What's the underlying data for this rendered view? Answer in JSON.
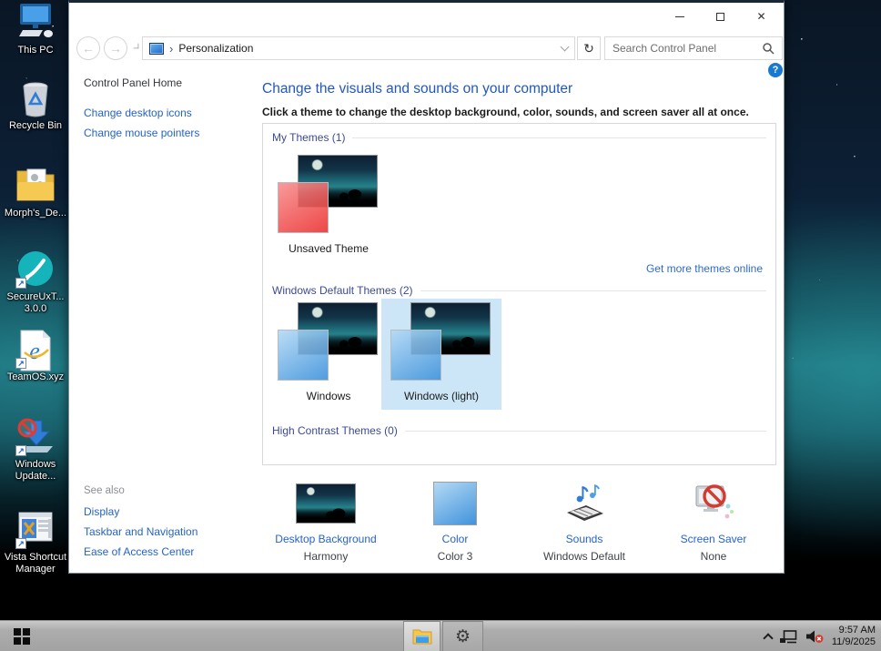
{
  "colors": {
    "link_blue": "#2563c9",
    "heading_blue": "#2156c6",
    "group_label_blue": "#3b4a97",
    "selection_blue": "#cde6f7",
    "help_blue": "#1878d2",
    "overlay_red": "#ee3c3c",
    "overlay_blue": "#4294db",
    "taskbar_gray": "#adadad"
  },
  "desktop": {
    "icons": [
      {
        "name": "this-pc",
        "label": "This PC"
      },
      {
        "name": "recycle-bin",
        "label": "Recycle Bin"
      },
      {
        "name": "morphs-folder",
        "label": "Morph's_De..."
      },
      {
        "name": "secureux-tool",
        "label": "SecureUxT... 3.0.0"
      },
      {
        "name": "teamos-link",
        "label": "TeamOS.xyz"
      },
      {
        "name": "windows-update-blocker",
        "label": "Windows Update..."
      },
      {
        "name": "vista-shortcut-manager",
        "label": "Vista Shortcut Manager"
      }
    ]
  },
  "window": {
    "address": "Personalization",
    "search_placeholder": "Search Control Panel",
    "sidebar": {
      "home": "Control Panel Home",
      "links": [
        "Change desktop icons",
        "Change mouse pointers"
      ],
      "see_also_title": "See also",
      "see_also_links": [
        "Display",
        "Taskbar and Navigation",
        "Ease of Access Center"
      ]
    },
    "main": {
      "heading": "Change the visuals and sounds on your computer",
      "subtitle": "Click a theme to change the desktop background, color, sounds, and screen saver all at once.",
      "my_themes_label": "My Themes (1)",
      "unsaved_theme": "Unsaved Theme",
      "get_more_link": "Get more themes online",
      "default_themes_label": "Windows Default Themes (2)",
      "theme_windows": "Windows",
      "theme_windows_light": "Windows (light)",
      "high_contrast_label": "High Contrast Themes (0)",
      "footer": [
        {
          "title": "Desktop Background",
          "value": "Harmony"
        },
        {
          "title": "Color",
          "value": "Color 3"
        },
        {
          "title": "Sounds",
          "value": "Windows Default"
        },
        {
          "title": "Screen Saver",
          "value": "None"
        }
      ]
    }
  },
  "taskbar": {
    "time": "9:57 AM",
    "date": "11/9/2025"
  },
  "icons": {
    "close": "✕",
    "breadcrumb_chevron": "›",
    "back_arrow": "←",
    "forward_arrow": "→",
    "refresh": "↻",
    "help": "?",
    "shortcut_arrow": "↗",
    "gear": "⚙",
    "ie_e": "e"
  }
}
